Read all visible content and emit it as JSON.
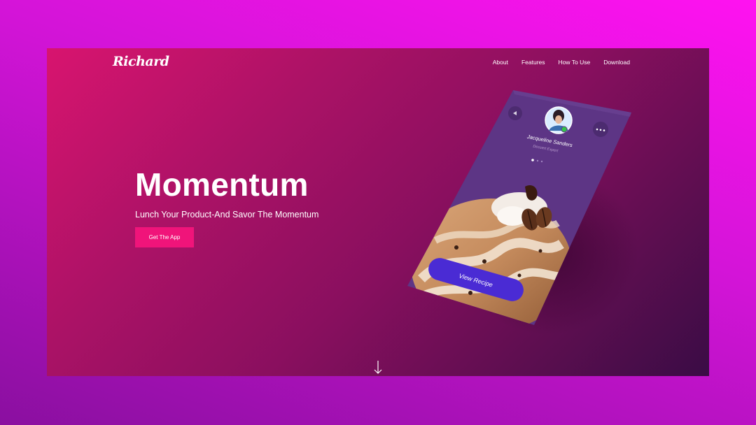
{
  "brand": {
    "logo_text": "Richard"
  },
  "nav": {
    "items": [
      {
        "label": "About"
      },
      {
        "label": "Features"
      },
      {
        "label": "How To Use"
      },
      {
        "label": "Download"
      }
    ]
  },
  "hero": {
    "title": "Momentum",
    "subtitle": "Lunch Your Product-And Savor The Momentum",
    "cta_label": "Get The App"
  },
  "phone": {
    "profile_name": "Jacqueline Sanders",
    "profile_role": "Dessert Expert",
    "button_label": "View Recipe",
    "icons": [
      "back-icon",
      "more-icon",
      "online-status-icon"
    ]
  },
  "scroll": {
    "icon": "arrow-down-icon"
  },
  "colors": {
    "accent": "#f0147a",
    "phone_bg": "#5d3585",
    "phone_button": "#4a2bd4",
    "outer_bg": "#d414d8"
  }
}
